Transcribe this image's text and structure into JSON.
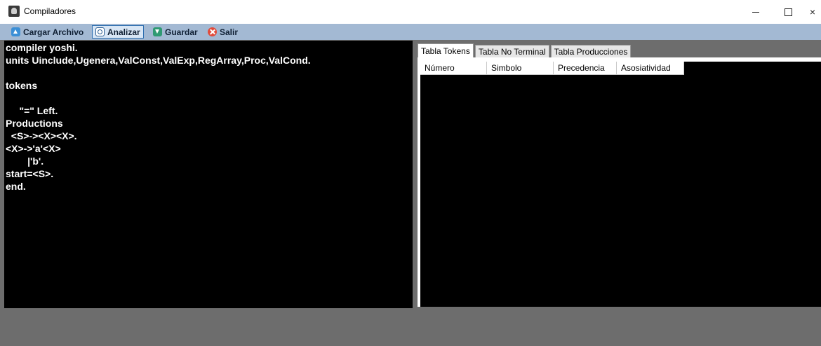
{
  "window": {
    "title": "Compiladores",
    "controls": {
      "minimize": "—",
      "maximize": "",
      "close": "×"
    }
  },
  "toolbar": {
    "items": [
      {
        "label": "Cargar Archivo",
        "icon": "upload-icon"
      },
      {
        "label": "Analizar",
        "icon": "search-icon",
        "selected": true
      },
      {
        "label": "Guardar",
        "icon": "save-icon"
      },
      {
        "label": "Salir",
        "icon": "exit-icon"
      }
    ]
  },
  "editor": {
    "content": "compiler yoshi.\nunits Uinclude,Ugenera,ValConst,ValExp,RegArray,Proc,ValCond.\n\ntokens\n\n     \"=\" Left.\nProductions\n  <S>-><X><X>.\n<X>->'a'<X>\n        |'b'.\nstart=<S>.\nend."
  },
  "tabs": {
    "items": [
      {
        "label": "Tabla Tokens",
        "active": true
      },
      {
        "label": "Tabla No Terminal"
      },
      {
        "label": "Tabla Producciones"
      }
    ]
  },
  "grid": {
    "columns": [
      "Número",
      "Simbolo",
      "Precedencia",
      "Asosiatividad"
    ],
    "rows": []
  },
  "colors": {
    "toolbar_bg": "#a3b9d3",
    "editor_bg": "#000000",
    "editor_fg": "#ffffff",
    "window_bg": "#6d6d6d"
  }
}
